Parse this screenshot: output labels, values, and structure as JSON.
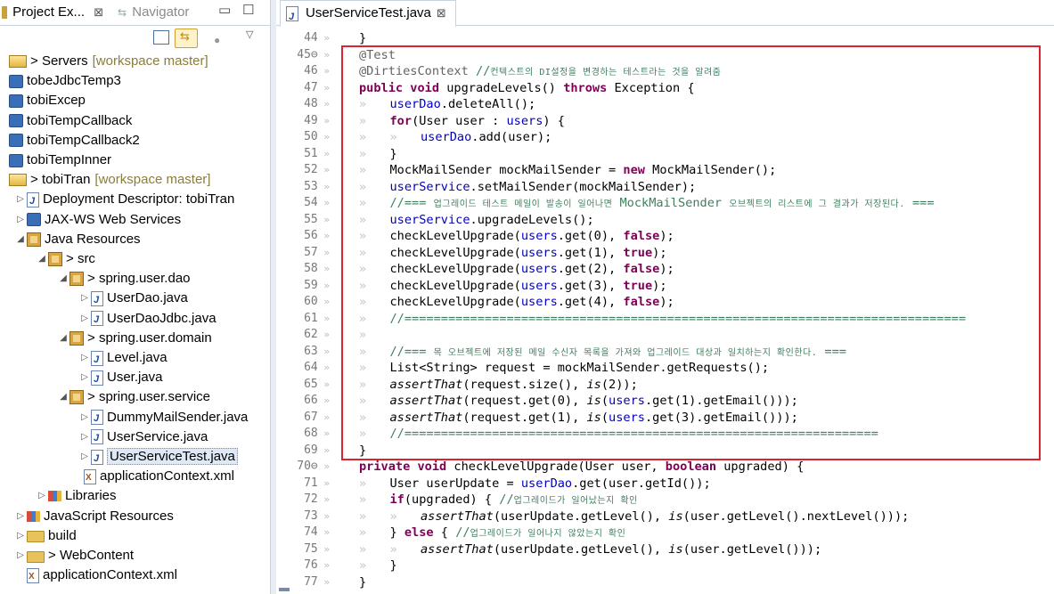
{
  "left_panel": {
    "tabs": [
      {
        "label": "Project Ex...",
        "icon": "project-explorer-icon",
        "close": "⊠"
      },
      {
        "label": "Navigator",
        "icon": "navigator-icon"
      }
    ],
    "tree": [
      {
        "indent": 0,
        "twisty": "",
        "icon": "server-project-icon",
        "prefix": "> ",
        "label": "Servers",
        "decoration": "[workspace master]"
      },
      {
        "indent": 0,
        "twisty": "",
        "icon": "project-icon",
        "prefix": "",
        "label": "tobeJdbcTemp3",
        "decoration": ""
      },
      {
        "indent": 0,
        "twisty": "",
        "icon": "project-icon",
        "prefix": "",
        "label": "tobiExcep",
        "decoration": ""
      },
      {
        "indent": 0,
        "twisty": "",
        "icon": "project-icon",
        "prefix": "",
        "label": "tobiTempCallback",
        "decoration": ""
      },
      {
        "indent": 0,
        "twisty": "",
        "icon": "project-icon",
        "prefix": "",
        "label": "tobiTempCallback2",
        "decoration": ""
      },
      {
        "indent": 0,
        "twisty": "",
        "icon": "project-icon",
        "prefix": "",
        "label": "tobiTempInner",
        "decoration": ""
      },
      {
        "indent": 0,
        "twisty": "",
        "icon": "web-project-icon",
        "prefix": "> ",
        "label": "tobiTran",
        "decoration": "[workspace master]"
      },
      {
        "indent": 1,
        "twisty": "▷",
        "icon": "deployment-descriptor-icon",
        "prefix": "",
        "label": "Deployment Descriptor: tobiTran",
        "decoration": ""
      },
      {
        "indent": 1,
        "twisty": "▷",
        "icon": "web-services-icon",
        "prefix": "",
        "label": "JAX-WS Web Services",
        "decoration": ""
      },
      {
        "indent": 1,
        "twisty": "◢",
        "icon": "java-resources-icon",
        "prefix": "",
        "label": "Java Resources",
        "decoration": ""
      },
      {
        "indent": 2,
        "twisty": "◢",
        "icon": "source-folder-icon",
        "prefix": "> ",
        "label": "src",
        "decoration": ""
      },
      {
        "indent": 3,
        "twisty": "◢",
        "icon": "package-icon",
        "prefix": "> ",
        "label": "spring.user.dao",
        "decoration": ""
      },
      {
        "indent": 4,
        "twisty": "▷",
        "icon": "java-file-icon",
        "prefix": "",
        "label": "UserDao.java",
        "decoration": ""
      },
      {
        "indent": 4,
        "twisty": "▷",
        "icon": "java-file-icon",
        "prefix": "",
        "label": "UserDaoJdbc.java",
        "decoration": ""
      },
      {
        "indent": 3,
        "twisty": "◢",
        "icon": "package-icon",
        "prefix": "> ",
        "label": "spring.user.domain",
        "decoration": ""
      },
      {
        "indent": 4,
        "twisty": "▷",
        "icon": "java-file-icon",
        "prefix": "",
        "label": "Level.java",
        "decoration": ""
      },
      {
        "indent": 4,
        "twisty": "▷",
        "icon": "java-file-icon",
        "prefix": "",
        "label": "User.java",
        "decoration": ""
      },
      {
        "indent": 3,
        "twisty": "◢",
        "icon": "package-icon",
        "prefix": "> ",
        "label": "spring.user.service",
        "decoration": ""
      },
      {
        "indent": 4,
        "twisty": "▷",
        "icon": "java-file-icon",
        "prefix": "",
        "label": "DummyMailSender.java",
        "decoration": ""
      },
      {
        "indent": 4,
        "twisty": "▷",
        "icon": "java-file-icon",
        "prefix": "",
        "label": "UserService.java",
        "decoration": ""
      },
      {
        "indent": 4,
        "twisty": "▷",
        "icon": "java-file-icon",
        "prefix": "",
        "label": "UserServiceTest.java",
        "decoration": "",
        "selected": true
      },
      {
        "indent": 3.5,
        "twisty": "",
        "icon": "xml-file-icon",
        "prefix": "",
        "label": "applicationContext.xml",
        "decoration": ""
      },
      {
        "indent": 2,
        "twisty": "▷",
        "icon": "libraries-icon",
        "prefix": "",
        "label": "Libraries",
        "decoration": ""
      },
      {
        "indent": 1,
        "twisty": "▷",
        "icon": "javascript-resources-icon",
        "prefix": "",
        "label": "JavaScript Resources",
        "decoration": ""
      },
      {
        "indent": 1,
        "twisty": "▷",
        "icon": "folder-icon",
        "prefix": "",
        "label": "build",
        "decoration": ""
      },
      {
        "indent": 1,
        "twisty": "▷",
        "icon": "web-folder-icon",
        "prefix": "> ",
        "label": "WebContent",
        "decoration": ""
      },
      {
        "indent": 1,
        "twisty": "",
        "icon": "xml-file-icon",
        "prefix": "",
        "label": "applicationContext.xml",
        "decoration": ""
      }
    ]
  },
  "editor": {
    "tab_label": "UserServiceTest.java",
    "tab_close": "⊠",
    "lines": [
      {
        "n": "44",
        "html": "}",
        "ind": 0
      },
      {
        "n": "45⊖",
        "html": "<span class='ann'>@Test</span>",
        "ind": 0
      },
      {
        "n": "46",
        "html": "<span class='ann'>@DirtiesContext</span> <span class='cm'>//<span class='ko'>컨텍스트의 DI설정을 변경하는 테스트라는 것을 알려줌</span></span>",
        "ind": 0
      },
      {
        "n": "47",
        "html": "<span class='kw'>public</span> <span class='kw'>void</span> upgradeLevels() <span class='kw'>throws</span> Exception {",
        "ind": 0
      },
      {
        "n": "48",
        "html": "<span class='fld'>userDao</span>.deleteAll();",
        "ind": 1
      },
      {
        "n": "49",
        "html": "<span class='kw'>for</span>(User user : <span class='fld'>users</span>) {",
        "ind": 1
      },
      {
        "n": "50",
        "html": "<span class='fld'>userDao</span>.add(user);",
        "ind": 2
      },
      {
        "n": "51",
        "html": "}",
        "ind": 1
      },
      {
        "n": "52",
        "html": "MockMailSender mockMailSender = <span class='kw'>new</span> MockMailSender();",
        "ind": 1
      },
      {
        "n": "53",
        "html": "<span class='fld'>userService</span>.setMailSender(mockMailSender);",
        "ind": 1
      },
      {
        "n": "54",
        "html": "<span class='cm'>//=== <span class='ko'>업그레이드 테스트 메일이 발송이 일어나면</span> MockMailSender <span class='ko'>오브젝트의 리스트에 그 결과가 저장된다.</span> ===</span>",
        "ind": 1
      },
      {
        "n": "55",
        "html": "<span class='fld'>userService</span>.upgradeLevels();",
        "ind": 1
      },
      {
        "n": "56",
        "html": "checkLevelUpgrade(<span class='fld'>users</span>.get(0), <span class='kw'>false</span>);",
        "ind": 1
      },
      {
        "n": "57",
        "html": "checkLevelUpgrade(<span class='fld'>users</span>.get(1), <span class='kw'>true</span>);",
        "ind": 1
      },
      {
        "n": "58",
        "html": "checkLevelUpgrade(<span class='fld'>users</span>.get(2), <span class='kw'>false</span>);",
        "ind": 1
      },
      {
        "n": "59",
        "html": "checkLevelUpgrade(<span class='fld'>users</span>.get(3), <span class='kw'>true</span>);",
        "ind": 1
      },
      {
        "n": "60",
        "html": "checkLevelUpgrade(<span class='fld'>users</span>.get(4), <span class='kw'>false</span>);",
        "ind": 1
      },
      {
        "n": "61",
        "html": "<span class='cm'>//=============================================================================</span>",
        "ind": 1
      },
      {
        "n": "62",
        "html": "",
        "ind": 1
      },
      {
        "n": "63",
        "html": "<span class='cm'>//=== <span class='ko'>목 오브젝트에 저장된 메일 수신자 목록을 가져와 업그레이드 대상과 일치하는지 확인한다.</span> ===</span>",
        "ind": 1
      },
      {
        "n": "64",
        "html": "List&lt;String&gt; request = mockMailSender.getRequests();",
        "ind": 1
      },
      {
        "n": "65",
        "html": "<span class='it'>assertThat</span>(request.size(), <span class='it'>is</span>(2));",
        "ind": 1
      },
      {
        "n": "66",
        "html": "<span class='it'>assertThat</span>(request.get(0), <span class='it'>is</span>(<span class='fld'>users</span>.get(1).getEmail()));",
        "ind": 1
      },
      {
        "n": "67",
        "html": "<span class='it'>assertThat</span>(request.get(1), <span class='it'>is</span>(<span class='fld'>users</span>.get(3).getEmail()));",
        "ind": 1
      },
      {
        "n": "68",
        "html": "<span class='cm'>//=================================================================</span>",
        "ind": 1
      },
      {
        "n": "69",
        "html": "}",
        "ind": 0
      },
      {
        "n": "70⊖",
        "html": "<span class='kw'>private</span> <span class='kw'>void</span> checkLevelUpgrade(User user, <span class='kw'>boolean</span> upgraded) {",
        "ind": 0
      },
      {
        "n": "71",
        "html": "User userUpdate = <span class='fld'>userDao</span>.get(user.getId());",
        "ind": 1
      },
      {
        "n": "72",
        "html": "<span class='kw'>if</span>(upgraded) { <span class='cm'>//<span class='ko'>업그레이드가 일어났는지 확인</span></span>",
        "ind": 1
      },
      {
        "n": "73",
        "html": "<span class='it'>assertThat</span>(userUpdate.getLevel(), <span class='it'>is</span>(user.getLevel().nextLevel()));",
        "ind": 2
      },
      {
        "n": "74",
        "html": "} <span class='kw'>else</span> { <span class='cm'>//<span class='ko'>업그레이드가 일어나지 않았는지 확인</span></span>",
        "ind": 1
      },
      {
        "n": "75",
        "html": "<span class='it'>assertThat</span>(userUpdate.getLevel(), <span class='it'>is</span>(user.getLevel()));",
        "ind": 2
      },
      {
        "n": "76",
        "html": "}",
        "ind": 1
      },
      {
        "n": "77",
        "html": "}",
        "ind": 0
      }
    ]
  }
}
